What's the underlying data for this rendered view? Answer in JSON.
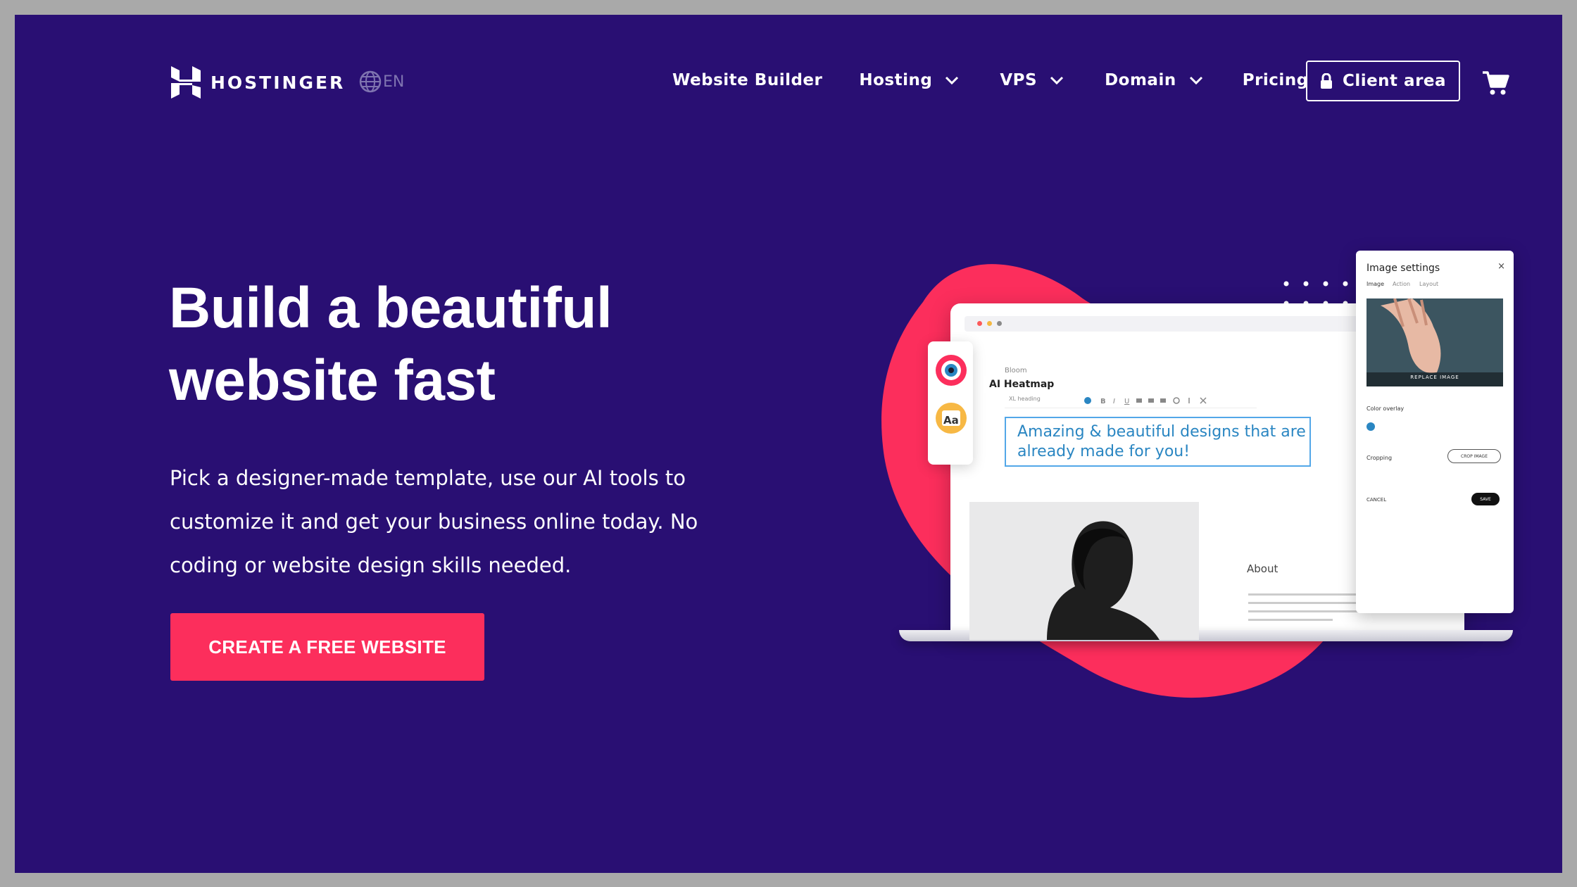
{
  "brand": {
    "name": "HOSTINGER",
    "lang": "EN"
  },
  "nav": {
    "items": [
      {
        "label": "Website Builder",
        "has_dropdown": false
      },
      {
        "label": "Hosting",
        "has_dropdown": true
      },
      {
        "label": "VPS",
        "has_dropdown": true
      },
      {
        "label": "Domain",
        "has_dropdown": true
      },
      {
        "label": "Pricing",
        "has_dropdown": false
      }
    ],
    "client_area": "Client area"
  },
  "hero": {
    "title_line1": "Build a beautiful",
    "title_line2": "website fast",
    "description": "Pick a designer-made template, use our AI tools to customize it and get your business online today. No coding or website design skills needed.",
    "cta": "CREATE A FREE WEBSITE"
  },
  "illustration": {
    "editor_site_name": "Bloom",
    "editor_heading_select": "XL heading",
    "editor_text": "Amazing & beautiful designs that are already made for you!",
    "ai_heatmap": "AI Heatmap",
    "about_heading": "About",
    "image_settings_title": "Image settings",
    "image_settings_tabs": [
      "Image",
      "Action",
      "Layout"
    ],
    "replace_image": "REPLACE IMAGE",
    "color_overlay": "Color overlay",
    "cropping": "Cropping",
    "crop_image": "CROP IMAGE",
    "cancel": "CANCEL",
    "save": "SAVE",
    "font_tool_label": "Aa"
  },
  "colors": {
    "background": "#290f73",
    "accent": "#fc2e5c",
    "frame": "#a9a9a9"
  }
}
